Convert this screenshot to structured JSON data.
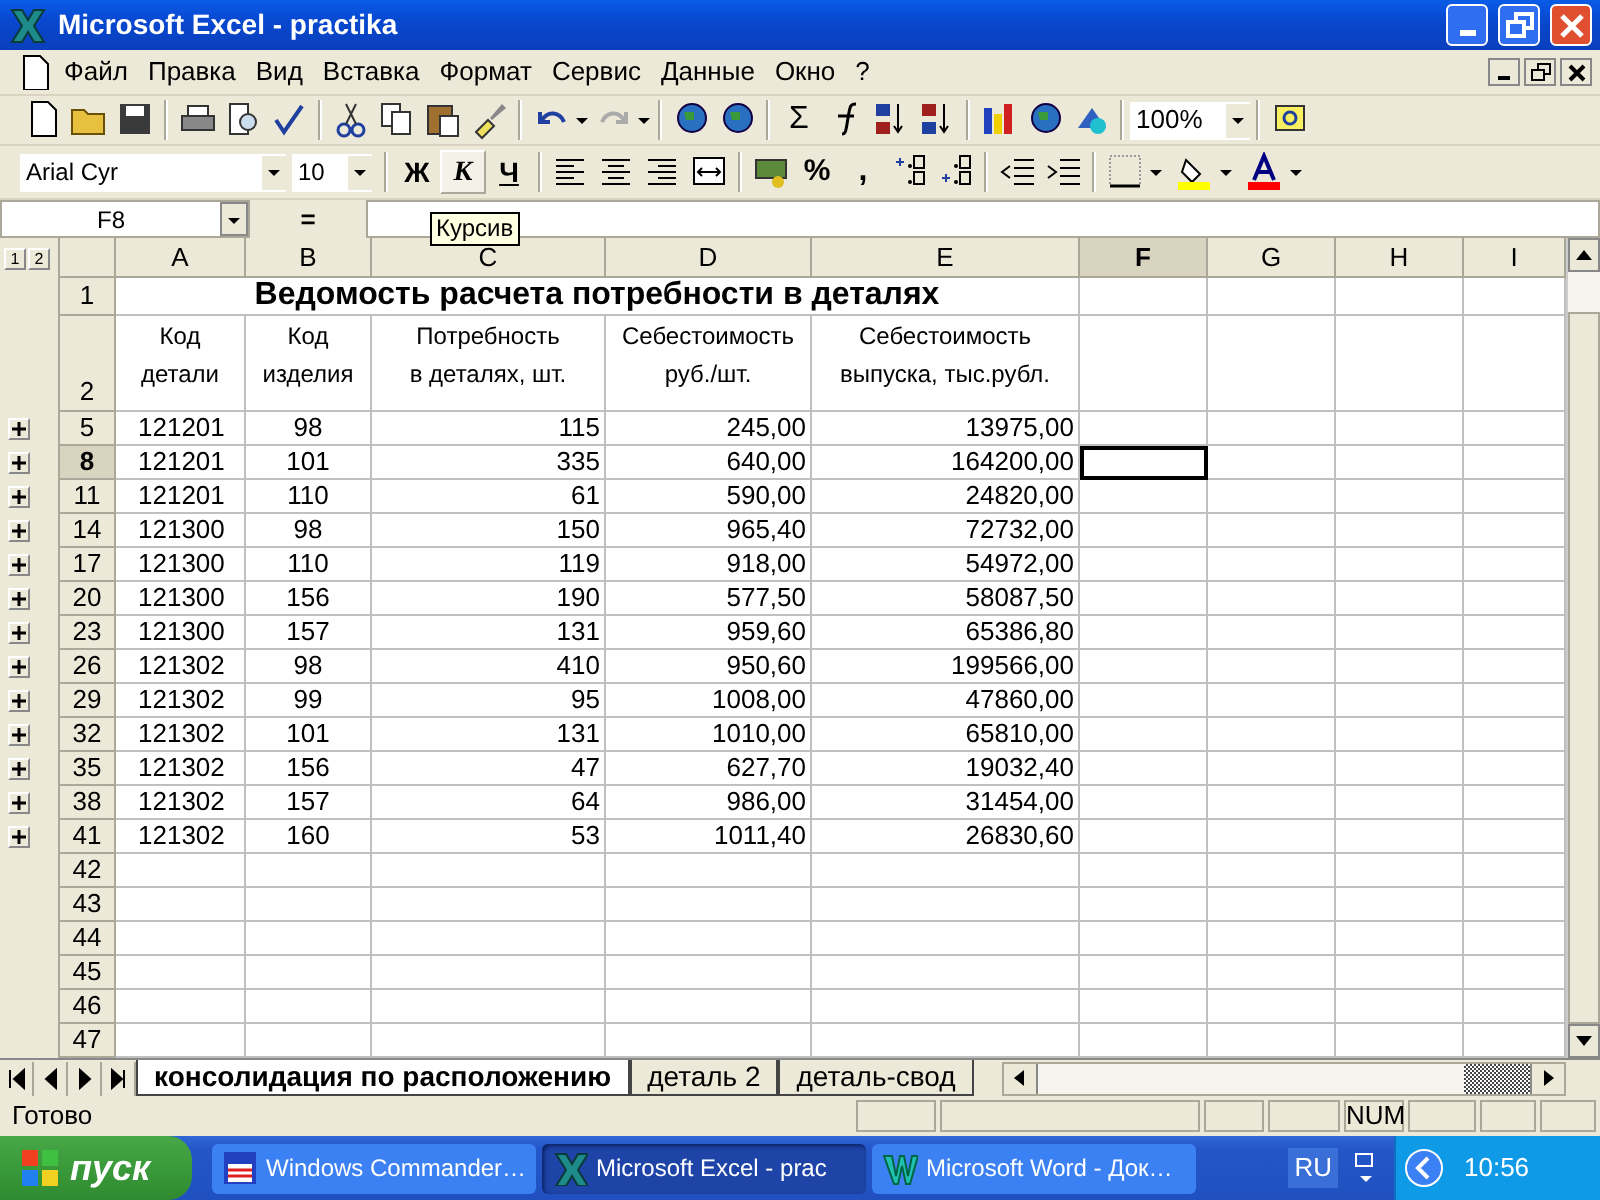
{
  "window": {
    "title": "Microsoft Excel - practika"
  },
  "menu": [
    {
      "label": "Файл"
    },
    {
      "label": "Правка"
    },
    {
      "label": "Вид"
    },
    {
      "label": "Вставка"
    },
    {
      "label": "Формат"
    },
    {
      "label": "Сервис"
    },
    {
      "label": "Данные"
    },
    {
      "label": "Окно"
    },
    {
      "label": "?"
    }
  ],
  "standard_toolbar": {
    "sum": "Σ",
    "zoom": "100%"
  },
  "formatting_toolbar": {
    "font": "Arial Cyr",
    "size": "10",
    "style_buttons": [
      {
        "label": "Ж",
        "kind": "bold",
        "hovered": false
      },
      {
        "label": "К",
        "kind": "italic",
        "hovered": true
      },
      {
        "label": "Ч",
        "kind": "underline",
        "hovered": false
      }
    ],
    "percent": "%",
    "comma": ","
  },
  "formula_bar": {
    "name_box": "F8",
    "equals": "="
  },
  "tooltip": "Курсив",
  "outline_levels": [
    "1",
    "2"
  ],
  "columns": [
    {
      "label": "A",
      "selected": false
    },
    {
      "label": "B",
      "selected": false
    },
    {
      "label": "C",
      "selected": false
    },
    {
      "label": "D",
      "selected": false
    },
    {
      "label": "E",
      "selected": false
    },
    {
      "label": "F",
      "selected": true
    },
    {
      "label": "G",
      "selected": false
    },
    {
      "label": "H",
      "selected": false
    },
    {
      "label": "I",
      "selected": false
    }
  ],
  "title_row": {
    "number": "1",
    "text": "Ведомость расчета потребности в деталях"
  },
  "header_row": {
    "number": "2",
    "cells": [
      "Код\nдетали",
      "Код\nизделия",
      "Потребность\nв деталях, шт.",
      "Себестоимость\nруб./шт.",
      "Себестоимость\nвыпуска, тыс.рубл."
    ]
  },
  "rows": [
    {
      "number": "5",
      "selected": false,
      "cells": [
        "121201",
        "98",
        "115",
        "245,00",
        "13975,00"
      ]
    },
    {
      "number": "8",
      "selected": true,
      "cells": [
        "121201",
        "101",
        "335",
        "640,00",
        "164200,00"
      ]
    },
    {
      "number": "11",
      "selected": false,
      "cells": [
        "121201",
        "110",
        "61",
        "590,00",
        "24820,00"
      ]
    },
    {
      "number": "14",
      "selected": false,
      "cells": [
        "121300",
        "98",
        "150",
        "965,40",
        "72732,00"
      ]
    },
    {
      "number": "17",
      "selected": false,
      "cells": [
        "121300",
        "110",
        "119",
        "918,00",
        "54972,00"
      ]
    },
    {
      "number": "20",
      "selected": false,
      "cells": [
        "121300",
        "156",
        "190",
        "577,50",
        "58087,50"
      ]
    },
    {
      "number": "23",
      "selected": false,
      "cells": [
        "121300",
        "157",
        "131",
        "959,60",
        "65386,80"
      ]
    },
    {
      "number": "26",
      "selected": false,
      "cells": [
        "121302",
        "98",
        "410",
        "950,60",
        "199566,00"
      ]
    },
    {
      "number": "29",
      "selected": false,
      "cells": [
        "121302",
        "99",
        "95",
        "1008,00",
        "47860,00"
      ]
    },
    {
      "number": "32",
      "selected": false,
      "cells": [
        "121302",
        "101",
        "131",
        "1010,00",
        "65810,00"
      ]
    },
    {
      "number": "35",
      "selected": false,
      "cells": [
        "121302",
        "156",
        "47",
        "627,70",
        "19032,40"
      ]
    },
    {
      "number": "38",
      "selected": false,
      "cells": [
        "121302",
        "157",
        "64",
        "986,00",
        "31454,00"
      ]
    },
    {
      "number": "41",
      "selected": false,
      "cells": [
        "121302",
        "160",
        "53",
        "1011,40",
        "26830,60"
      ]
    }
  ],
  "empty_rows": [
    "42",
    "43",
    "44",
    "45",
    "46",
    "47"
  ],
  "sheet_tabs": [
    {
      "label": "консолидация по расположению",
      "selected": true
    },
    {
      "label": "деталь 2",
      "selected": false
    },
    {
      "label": "деталь-свод",
      "selected": false
    }
  ],
  "status_bar": {
    "text": "Готово",
    "indicators": [
      "NUM"
    ]
  },
  "taskbar": {
    "start": "пуск",
    "tasks": [
      {
        "label": "Windows Commander…",
        "kind": "commander",
        "selected": false
      },
      {
        "label": "Microsoft Excel - prac",
        "kind": "excel",
        "selected": true
      },
      {
        "label": "Microsoft Word - Док…",
        "kind": "word",
        "selected": false
      }
    ],
    "language": "RU",
    "clock": "10:56"
  }
}
